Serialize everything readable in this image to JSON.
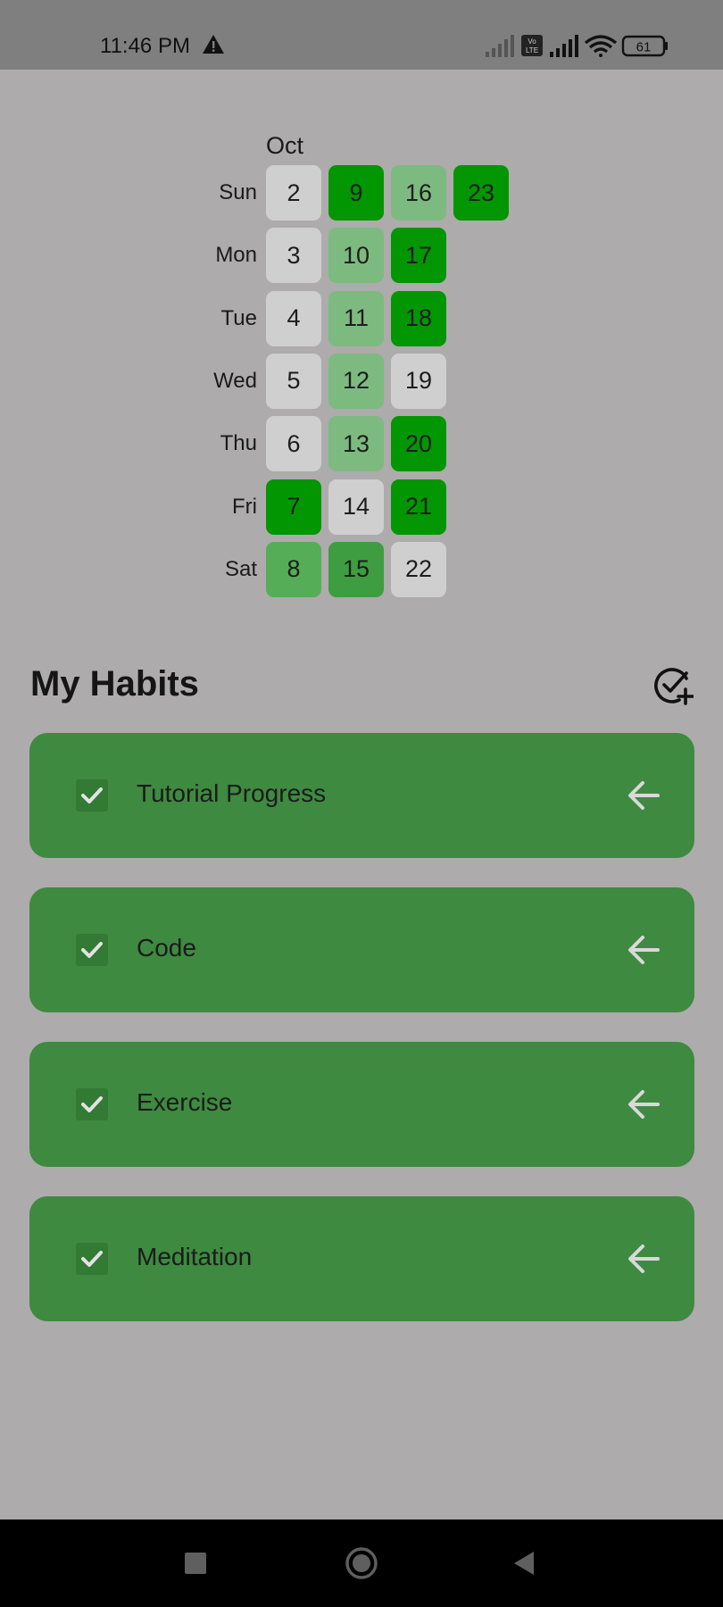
{
  "status_bar": {
    "time": "11:46 PM",
    "battery": "61",
    "icons": [
      "warning-icon",
      "signal-icon",
      "volte-icon",
      "signal-icon",
      "wifi-icon",
      "battery-icon"
    ]
  },
  "calendar": {
    "month": "Oct",
    "days": [
      "Sun",
      "Mon",
      "Tue",
      "Wed",
      "Thu",
      "Fri",
      "Sat"
    ],
    "colors": {
      "none": "#cfcfcf",
      "light": "#7dba7f",
      "medium": "#56ad58",
      "strong": "#3f9d41",
      "full": "#029602"
    },
    "weeks": [
      [
        {
          "day": "2",
          "level": "none"
        },
        {
          "day": "3",
          "level": "none"
        },
        {
          "day": "4",
          "level": "none"
        },
        {
          "day": "5",
          "level": "none"
        },
        {
          "day": "6",
          "level": "none"
        },
        {
          "day": "7",
          "level": "full"
        },
        {
          "day": "8",
          "level": "medium"
        }
      ],
      [
        {
          "day": "9",
          "level": "full"
        },
        {
          "day": "10",
          "level": "light"
        },
        {
          "day": "11",
          "level": "light"
        },
        {
          "day": "12",
          "level": "light"
        },
        {
          "day": "13",
          "level": "light"
        },
        {
          "day": "14",
          "level": "none"
        },
        {
          "day": "15",
          "level": "strong"
        }
      ],
      [
        {
          "day": "16",
          "level": "light"
        },
        {
          "day": "17",
          "level": "full"
        },
        {
          "day": "18",
          "level": "full"
        },
        {
          "day": "19",
          "level": "none"
        },
        {
          "day": "20",
          "level": "full"
        },
        {
          "day": "21",
          "level": "full"
        },
        {
          "day": "22",
          "level": "none"
        }
      ],
      [
        {
          "day": "23",
          "level": "full"
        }
      ]
    ]
  },
  "habits_section": {
    "title": "My Habits",
    "add_icon": "add-task-icon",
    "items": [
      {
        "name": "Tutorial Progress",
        "checked": true
      },
      {
        "name": "Code",
        "checked": true
      },
      {
        "name": "Exercise",
        "checked": true
      },
      {
        "name": "Meditation",
        "checked": true
      }
    ]
  },
  "nav_bar": {
    "buttons": [
      "recents-icon",
      "home-icon",
      "back-icon"
    ]
  }
}
